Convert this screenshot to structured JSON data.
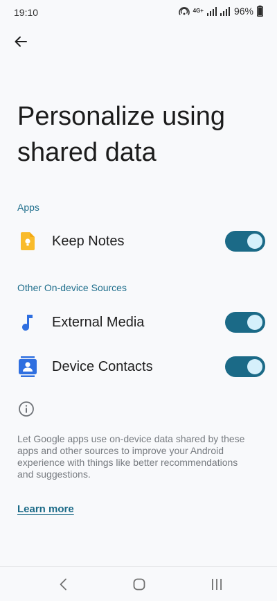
{
  "status_bar": {
    "time": "19:10",
    "network": "4G+",
    "battery": "96%"
  },
  "page": {
    "title": "Personalize using shared data"
  },
  "sections": {
    "apps": {
      "header": "Apps",
      "items": [
        {
          "label": "Keep Notes",
          "icon": "keep-notes-icon",
          "enabled": true
        }
      ]
    },
    "other": {
      "header": "Other On-device Sources",
      "items": [
        {
          "label": "External Media",
          "icon": "music-note-icon",
          "enabled": true
        },
        {
          "label": "Device Contacts",
          "icon": "contacts-icon",
          "enabled": true
        }
      ]
    }
  },
  "footer": {
    "description": "Let Google apps use on-device data shared by these apps and other sources to improve your Android experience with things like better recommendations and suggestions.",
    "learn_more": "Learn more"
  },
  "colors": {
    "accent": "#1b6a87",
    "section_header": "#1f6e8c",
    "keep_yellow": "#f9bb2b",
    "icon_blue": "#2f6fe0"
  }
}
